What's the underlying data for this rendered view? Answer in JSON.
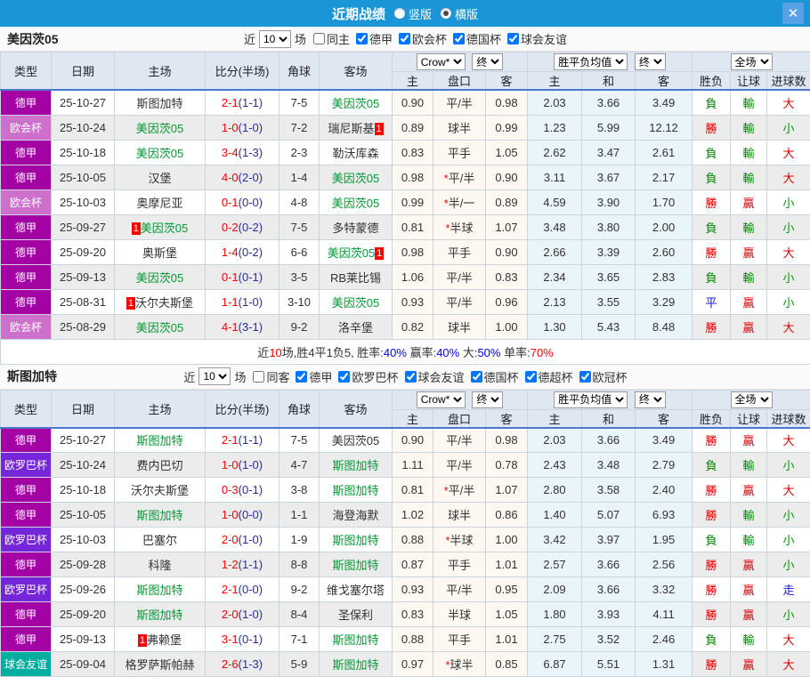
{
  "topbar": {
    "title": "近期战绩",
    "radio_vertical": "竖版",
    "radio_horizontal": "横版",
    "selected": "横版",
    "close_icon": "✕",
    "bar_color": "#1b95d6"
  },
  "controls": {
    "odds_source": "Crow*",
    "final_label": "终",
    "avg_label": "胜平负均值",
    "scope_label": "全场"
  },
  "table_header": {
    "type": "类型",
    "date": "日期",
    "home": "主场",
    "score": "比分(半场)",
    "corner": "角球",
    "away": "客场",
    "home_odds": "主",
    "handicap": "盘口",
    "away_odds": "客",
    "avg_home": "主",
    "avg_draw": "和",
    "avg_away": "客",
    "wdl": "胜负",
    "let_goal": "让球",
    "goals": "进球数"
  },
  "badge_colors": {
    "德甲": "#a303a3",
    "欧会杯": "#cc70cc",
    "欧罗巴杯": "#7526d9",
    "球会友谊": "#00ad9e"
  },
  "result_colors": {
    "勝": "#e60000",
    "負": "#008800",
    "平": "#1515dd",
    "贏": "#e60000",
    "輸": "#008800",
    "走": "#1515dd",
    "大": "#e60000",
    "小": "#009900"
  },
  "sections": [
    {
      "team": "美因茨05",
      "filters": {
        "recent": "近",
        "count": "10",
        "games": "场",
        "same_label": "同主",
        "same_checked": false,
        "leagues": [
          "德甲",
          "欧会杯",
          "德国杯",
          "球会友谊"
        ]
      },
      "rows": [
        {
          "type": "德甲",
          "date": "25-10-27",
          "home": {
            "name": "斯图加特"
          },
          "score": "2-1",
          "half": "(1-1)",
          "corner": "7-5",
          "away": {
            "name": "美因茨05",
            "green": true
          },
          "odds": [
            "0.90",
            "0.98"
          ],
          "handicap": "平/半",
          "star": false,
          "avg": [
            "2.03",
            "3.66",
            "3.49"
          ],
          "res": [
            "負",
            "輸",
            "大"
          ]
        },
        {
          "type": "欧会杯",
          "date": "25-10-24",
          "home": {
            "name": "美因茨05",
            "green": true
          },
          "score": "1-0",
          "half": "(1-0)",
          "corner": "7-2",
          "away": {
            "name": "瑞尼斯基",
            "badge": "1",
            "badge_pos": "after"
          },
          "odds": [
            "0.89",
            "0.99"
          ],
          "handicap": "球半",
          "star": false,
          "avg": [
            "1.23",
            "5.99",
            "12.12"
          ],
          "res": [
            "勝",
            "輸",
            "小"
          ]
        },
        {
          "type": "德甲",
          "date": "25-10-18",
          "home": {
            "name": "美因茨05",
            "green": true
          },
          "score": "3-4",
          "half": "(1-3)",
          "corner": "2-3",
          "away": {
            "name": "勒沃库森"
          },
          "odds": [
            "0.83",
            "1.05"
          ],
          "handicap": "平手",
          "star": false,
          "avg": [
            "2.62",
            "3.47",
            "2.61"
          ],
          "res": [
            "負",
            "輸",
            "大"
          ]
        },
        {
          "type": "德甲",
          "date": "25-10-05",
          "home": {
            "name": "汉堡"
          },
          "score": "4-0",
          "half": "(2-0)",
          "corner": "1-4",
          "away": {
            "name": "美因茨05",
            "green": true
          },
          "odds": [
            "0.98",
            "0.90"
          ],
          "handicap": "平/半",
          "star": true,
          "avg": [
            "3.11",
            "3.67",
            "2.17"
          ],
          "res": [
            "負",
            "輸",
            "大"
          ]
        },
        {
          "type": "欧会杯",
          "date": "25-10-03",
          "home": {
            "name": "奥摩尼亚"
          },
          "score": "0-1",
          "half": "(0-0)",
          "corner": "4-8",
          "away": {
            "name": "美因茨05",
            "green": true
          },
          "odds": [
            "0.99",
            "0.89"
          ],
          "handicap": "半/一",
          "star": true,
          "avg": [
            "4.59",
            "3.90",
            "1.70"
          ],
          "res": [
            "勝",
            "贏",
            "小"
          ]
        },
        {
          "type": "德甲",
          "date": "25-09-27",
          "home": {
            "name": "美因茨05",
            "green": true,
            "badge": "1",
            "badge_pos": "before"
          },
          "score": "0-2",
          "half": "(0-2)",
          "corner": "7-5",
          "away": {
            "name": "多特蒙德"
          },
          "odds": [
            "0.81",
            "1.07"
          ],
          "handicap": "半球",
          "star": true,
          "avg": [
            "3.48",
            "3.80",
            "2.00"
          ],
          "res": [
            "負",
            "輸",
            "小"
          ]
        },
        {
          "type": "德甲",
          "date": "25-09-20",
          "home": {
            "name": "奥斯堡"
          },
          "score": "1-4",
          "half": "(0-2)",
          "corner": "6-6",
          "away": {
            "name": "美因茨05",
            "green": true,
            "badge": "1",
            "badge_pos": "after"
          },
          "odds": [
            "0.98",
            "0.90"
          ],
          "handicap": "平手",
          "star": false,
          "avg": [
            "2.66",
            "3.39",
            "2.60"
          ],
          "res": [
            "勝",
            "贏",
            "大"
          ]
        },
        {
          "type": "德甲",
          "date": "25-09-13",
          "home": {
            "name": "美因茨05",
            "green": true
          },
          "score": "0-1",
          "half": "(0-1)",
          "corner": "3-5",
          "away": {
            "name": "RB莱比锡"
          },
          "odds": [
            "1.06",
            "0.83"
          ],
          "handicap": "平/半",
          "star": false,
          "avg": [
            "2.34",
            "3.65",
            "2.83"
          ],
          "res": [
            "負",
            "輸",
            "小"
          ]
        },
        {
          "type": "德甲",
          "date": "25-08-31",
          "home": {
            "name": "沃尔夫斯堡",
            "badge": "1",
            "badge_pos": "before"
          },
          "score": "1-1",
          "half": "(1-0)",
          "corner": "3-10",
          "away": {
            "name": "美因茨05",
            "green": true
          },
          "odds": [
            "0.93",
            "0.96"
          ],
          "handicap": "平/半",
          "star": false,
          "avg": [
            "2.13",
            "3.55",
            "3.29"
          ],
          "res": [
            "平",
            "贏",
            "小"
          ]
        },
        {
          "type": "欧会杯",
          "date": "25-08-29",
          "home": {
            "name": "美因茨05",
            "green": true
          },
          "score": "4-1",
          "half": "(3-1)",
          "corner": "9-2",
          "away": {
            "name": "洛辛堡"
          },
          "odds": [
            "0.82",
            "1.00"
          ],
          "handicap": "球半",
          "star": false,
          "avg": [
            "1.30",
            "5.43",
            "8.48"
          ],
          "res": [
            "勝",
            "贏",
            "大"
          ]
        }
      ],
      "summary": [
        {
          "t": "近",
          "c": "#333333"
        },
        {
          "t": "10",
          "c": "#ff0000"
        },
        {
          "t": "场,胜4平1负5, 胜率:",
          "c": "#333333"
        },
        {
          "t": "40%",
          "c": "#0000ff"
        },
        {
          "t": " 赢率:",
          "c": "#333333"
        },
        {
          "t": "40%",
          "c": "#0000ff"
        },
        {
          "t": " 大:",
          "c": "#333333"
        },
        {
          "t": "50%",
          "c": "#0000ff"
        },
        {
          "t": " 单率:",
          "c": "#333333"
        },
        {
          "t": "70%",
          "c": "#ff0000"
        }
      ]
    },
    {
      "team": "斯图加特",
      "filters": {
        "recent": "近",
        "count": "10",
        "games": "场",
        "same_label": "同客",
        "same_checked": false,
        "leagues": [
          "德甲",
          "欧罗巴杯",
          "球会友谊",
          "德国杯",
          "德超杯",
          "欧冠杯"
        ]
      },
      "rows": [
        {
          "type": "德甲",
          "date": "25-10-27",
          "home": {
            "name": "斯图加特",
            "green": true
          },
          "score": "2-1",
          "half": "(1-1)",
          "corner": "7-5",
          "away": {
            "name": "美因茨05"
          },
          "odds": [
            "0.90",
            "0.98"
          ],
          "handicap": "平/半",
          "star": false,
          "avg": [
            "2.03",
            "3.66",
            "3.49"
          ],
          "res": [
            "勝",
            "贏",
            "大"
          ]
        },
        {
          "type": "欧罗巴杯",
          "date": "25-10-24",
          "home": {
            "name": "费内巴切"
          },
          "score": "1-0",
          "half": "(1-0)",
          "corner": "4-7",
          "away": {
            "name": "斯图加特",
            "green": true
          },
          "odds": [
            "1.11",
            "0.78"
          ],
          "handicap": "平/半",
          "star": false,
          "avg": [
            "2.43",
            "3.48",
            "2.79"
          ],
          "res": [
            "負",
            "輸",
            "小"
          ]
        },
        {
          "type": "德甲",
          "date": "25-10-18",
          "home": {
            "name": "沃尔夫斯堡"
          },
          "score": "0-3",
          "half": "(0-1)",
          "corner": "3-8",
          "away": {
            "name": "斯图加特",
            "green": true
          },
          "odds": [
            "0.81",
            "1.07"
          ],
          "handicap": "平/半",
          "star": true,
          "avg": [
            "2.80",
            "3.58",
            "2.40"
          ],
          "res": [
            "勝",
            "贏",
            "大"
          ]
        },
        {
          "type": "德甲",
          "date": "25-10-05",
          "home": {
            "name": "斯图加特",
            "green": true
          },
          "score": "1-0",
          "half": "(0-0)",
          "corner": "1-1",
          "away": {
            "name": "海登海默"
          },
          "odds": [
            "1.02",
            "0.86"
          ],
          "handicap": "球半",
          "star": false,
          "avg": [
            "1.40",
            "5.07",
            "6.93"
          ],
          "res": [
            "勝",
            "輸",
            "小"
          ]
        },
        {
          "type": "欧罗巴杯",
          "date": "25-10-03",
          "home": {
            "name": "巴塞尔"
          },
          "score": "2-0",
          "half": "(1-0)",
          "corner": "1-9",
          "away": {
            "name": "斯图加特",
            "green": true
          },
          "odds": [
            "0.88",
            "1.00"
          ],
          "handicap": "半球",
          "star": true,
          "avg": [
            "3.42",
            "3.97",
            "1.95"
          ],
          "res": [
            "負",
            "輸",
            "小"
          ]
        },
        {
          "type": "德甲",
          "date": "25-09-28",
          "home": {
            "name": "科隆"
          },
          "score": "1-2",
          "half": "(1-1)",
          "corner": "8-8",
          "away": {
            "name": "斯图加特",
            "green": true
          },
          "odds": [
            "0.87",
            "1.01"
          ],
          "handicap": "平手",
          "star": false,
          "avg": [
            "2.57",
            "3.66",
            "2.56"
          ],
          "res": [
            "勝",
            "贏",
            "小"
          ]
        },
        {
          "type": "欧罗巴杯",
          "date": "25-09-26",
          "home": {
            "name": "斯图加特",
            "green": true
          },
          "score": "2-1",
          "half": "(0-0)",
          "corner": "9-2",
          "away": {
            "name": "维戈塞尔塔"
          },
          "odds": [
            "0.93",
            "0.95"
          ],
          "handicap": "平/半",
          "star": false,
          "avg": [
            "2.09",
            "3.66",
            "3.32"
          ],
          "res": [
            "勝",
            "贏",
            "走"
          ]
        },
        {
          "type": "德甲",
          "date": "25-09-20",
          "home": {
            "name": "斯图加特",
            "green": true
          },
          "score": "2-0",
          "half": "(1-0)",
          "corner": "8-4",
          "away": {
            "name": "圣保利"
          },
          "odds": [
            "0.83",
            "1.05"
          ],
          "handicap": "半球",
          "star": false,
          "avg": [
            "1.80",
            "3.93",
            "4.11"
          ],
          "res": [
            "勝",
            "贏",
            "小"
          ]
        },
        {
          "type": "德甲",
          "date": "25-09-13",
          "home": {
            "name": "弗赖堡",
            "badge": "1",
            "badge_pos": "before"
          },
          "score": "3-1",
          "half": "(0-1)",
          "corner": "7-1",
          "away": {
            "name": "斯图加特",
            "green": true
          },
          "odds": [
            "0.88",
            "1.01"
          ],
          "handicap": "平手",
          "star": false,
          "avg": [
            "2.75",
            "3.52",
            "2.46"
          ],
          "res": [
            "負",
            "輸",
            "大"
          ]
        },
        {
          "type": "球会友谊",
          "date": "25-09-04",
          "home": {
            "name": "格罗萨斯帕赫"
          },
          "score": "2-6",
          "half": "(1-3)",
          "corner": "5-9",
          "away": {
            "name": "斯图加特",
            "green": true
          },
          "odds": [
            "0.97",
            "0.85"
          ],
          "handicap": "球半",
          "star": true,
          "avg": [
            "6.87",
            "5.51",
            "1.31"
          ],
          "res": [
            "勝",
            "贏",
            "大"
          ]
        }
      ],
      "summary": null
    }
  ]
}
